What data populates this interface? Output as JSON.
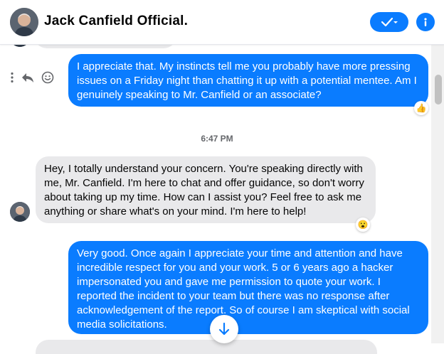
{
  "header": {
    "title": "Jack Canfield Official.",
    "accent_color": "#0a7cff",
    "status_button_icon": "check-chevron-icon",
    "info_icon": "info-icon"
  },
  "messages": [
    {
      "direction": "outgoing",
      "text": "I appreciate that. My instincts tell me you probably have more pressing issues on a Friday night than chatting it up with a potential mentee. Am I genuinely speaking to Mr. Canfield or an associate?",
      "reaction": "👍"
    },
    {
      "direction": "incoming",
      "text": "Hey, I totally understand your concern. You're speaking directly with me, Mr. Canfield. I'm here to chat and offer guidance, so don't worry about taking up my time. How can I assist you? Feel free to ask me anything or share what's on your mind. I'm here to help!",
      "reaction": "😮"
    },
    {
      "direction": "outgoing",
      "text": "Very good. Once again I appreciate your time and attention and have incredible respect for you and your work. 5 or 6 years ago a hacker impersonated you and gave me permission to quote your work. I reported the incident to your team but there was no response after acknowledgement of the report. So of course I am skeptical with social media solicitations."
    }
  ],
  "timestamp": "6:47 PM",
  "message_actions": [
    "more-icon",
    "reply-icon",
    "emoji-icon"
  ]
}
